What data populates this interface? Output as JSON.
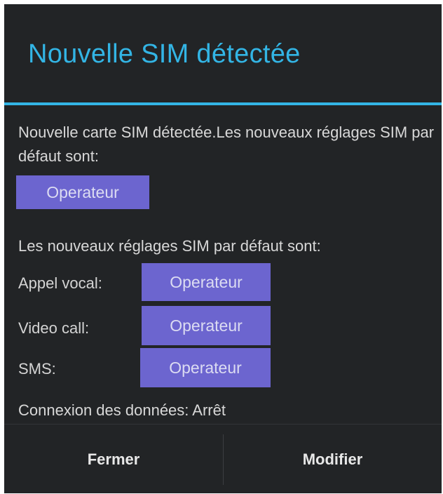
{
  "dialog": {
    "title": "Nouvelle SIM détectée",
    "intro_text": "Nouvelle carte SIM détectée.Les nouveaux réglages SIM par défaut sont:",
    "default_sim_chip": "Operateur",
    "section_text": "Les nouveaux réglages SIM par défaut sont:",
    "rows": [
      {
        "label": "Appel vocal:",
        "chip": "Operateur"
      },
      {
        "label": "Video call:",
        "chip": "Operateur"
      },
      {
        "label": "SMS:",
        "chip": "Operateur"
      }
    ],
    "data_connection_text": "Connexion des données: Arrêt",
    "buttons": {
      "close": "Fermer",
      "modify": "Modifier"
    }
  },
  "colors": {
    "background": "#222426",
    "accent": "#33b5e5",
    "chip": "#6c65cf"
  }
}
